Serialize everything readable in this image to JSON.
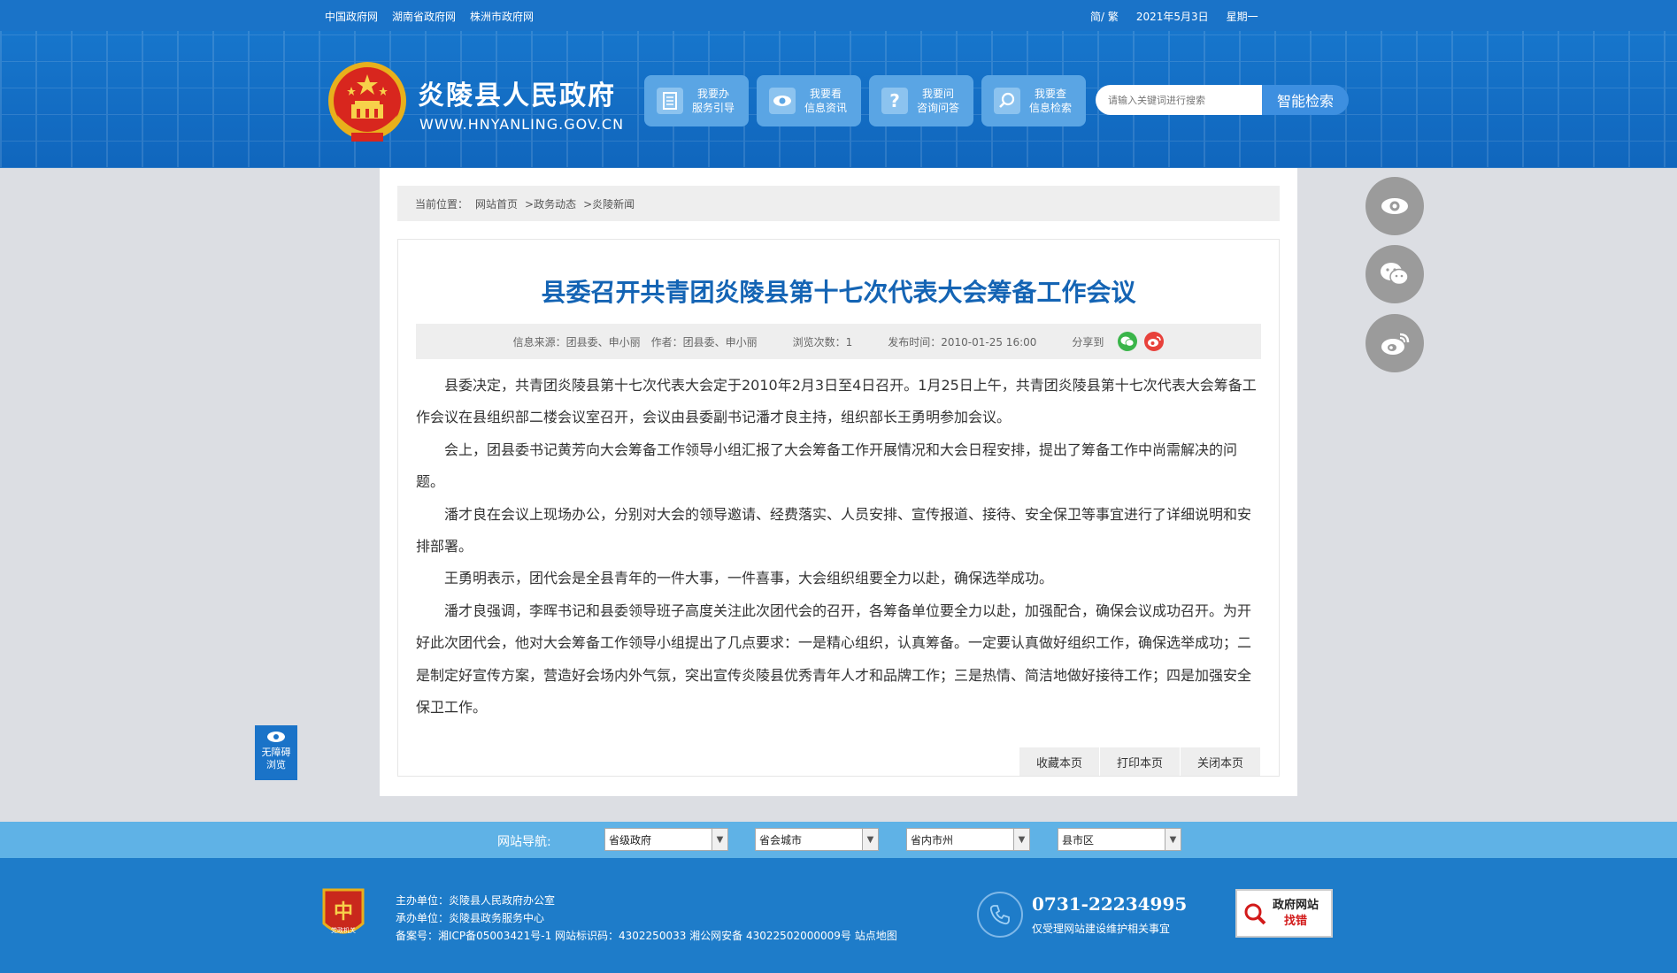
{
  "topbar": {
    "links": [
      "中国政府网",
      "湖南省政府网",
      "株洲市政府网"
    ],
    "lang": "简/ 繁",
    "date": "2021年5月3日",
    "weekday": "星期一"
  },
  "header": {
    "site_name": "炎陵县人民政府",
    "site_domain": "WWW.HNYANLING.GOV.CN",
    "nav": [
      {
        "line1": "我要办",
        "line2": "服务引导"
      },
      {
        "line1": "我要看",
        "line2": "信息资讯"
      },
      {
        "line1": "我要问",
        "line2": "咨询问答"
      },
      {
        "line1": "我要查",
        "line2": "信息检索"
      }
    ],
    "search_placeholder": "请输入关键词进行搜索",
    "search_button": "智能检索"
  },
  "breadcrumb": {
    "label": "当前位置：",
    "items": [
      "网站首页",
      ">政务动态",
      ">炎陵新闻"
    ]
  },
  "article": {
    "title": "县委召开共青团炎陵县第十七次代表大会筹备工作会议",
    "source": "信息来源：团县委、申小丽",
    "author": "作者：团县委、申小丽",
    "views": "浏览次数：1",
    "published": "发布时间：2010-01-25 16:00",
    "share_label": "分享到",
    "paragraphs": [
      "县委决定，共青团炎陵县第十七次代表大会定于2010年2月3日至4日召开。1月25日上午，共青团炎陵县第十七次代表大会筹备工作会议在县组织部二楼会议室召开，会议由县委副书记潘才良主持，组织部长王勇明参加会议。",
      "会上，团县委书记黄芳向大会筹备工作领导小组汇报了大会筹备工作开展情况和大会日程安排，提出了筹备工作中尚需解决的问题。",
      "潘才良在会议上现场办公，分别对大会的领导邀请、经费落实、人员安排、宣传报道、接待、安全保卫等事宜进行了详细说明和安排部署。",
      "王勇明表示，团代会是全县青年的一件大事，一件喜事，大会组织组要全力以赴，确保选举成功。",
      "潘才良强调，李晖书记和县委领导班子高度关注此次团代会的召开，各筹备单位要全力以赴，加强配合，确保会议成功召开。为开好此次团代会，他对大会筹备工作领导小组提出了几点要求：一是精心组织，认真筹备。一定要认真做好组织工作，确保选举成功；二是制定好宣传方案，营造好会场内外气氛，突出宣传炎陵县优秀青年人才和品牌工作；三是热情、简洁地做好接待工作；四是加强安全保卫工作。"
    ],
    "actions": [
      "收藏本页",
      "打印本页",
      "关闭本页"
    ]
  },
  "accessibility": {
    "line1": "无障碍",
    "line2": "浏览"
  },
  "site_nav": {
    "label": "网站导航:",
    "selects": [
      "省级政府",
      "省会城市",
      "省内市州",
      "县市区"
    ]
  },
  "footer": {
    "host": "主办单位：炎陵县人民政府办公室",
    "undertaker": "承办单位：炎陵县政务服务中心",
    "record": "备案号：湘ICP备05003421号-1 网站标识码：4302250033 湘公网安备 43022502000009号 站点地图",
    "badge_text": "党政机关",
    "phone": "0731-22234995",
    "phone_desc": "仅受理网站建设维护相关事宜",
    "report_line1": "政府网站",
    "report_line2": "找错"
  },
  "colors": {
    "brand_blue": "#1a73c8",
    "title_blue": "#1464b4",
    "nav_button": "#5aa5e4",
    "sitenav_bar": "#5fb2e6",
    "footer_bg": "#1e7cc9"
  }
}
